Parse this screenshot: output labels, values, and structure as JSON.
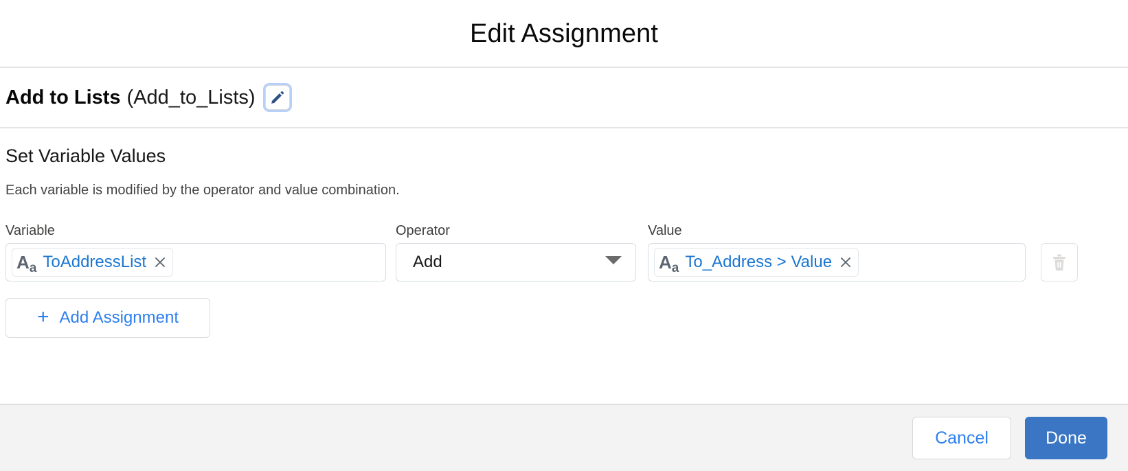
{
  "modal": {
    "title": "Edit Assignment"
  },
  "element": {
    "label": "Add to Lists",
    "api_name": "(Add_to_Lists)",
    "edit_icon": "pencil-icon",
    "edit_button_tooltip": "Edit"
  },
  "section": {
    "heading": "Set Variable Values",
    "description": "Each variable is modified by the operator and value combination."
  },
  "assignment_table": {
    "columns": {
      "variable": "Variable",
      "operator": "Operator",
      "value": "Value"
    },
    "rows": [
      {
        "variable": {
          "icon": "text-format-icon",
          "icon_text": "Aa",
          "text": "ToAddressList",
          "remove_icon": "close-icon"
        },
        "operator": {
          "selected": "Add",
          "arrow_icon": "chevron-down-icon"
        },
        "value": {
          "icon": "text-format-icon",
          "icon_text": "Aa",
          "text": "To_Address > Value",
          "remove_icon": "close-icon"
        },
        "delete": {
          "icon": "trash-icon",
          "enabled": false
        }
      }
    ]
  },
  "actions": {
    "add_assignment": {
      "plus_icon": "plus-icon",
      "label": "Add Assignment"
    },
    "cancel": "Cancel",
    "done": "Done"
  },
  "colors": {
    "link_blue": "#2d7ff0",
    "pill_blue": "#1b76d2",
    "primary_button": "#3a76c4",
    "footer_bg": "#f3f3f3",
    "border": "#d8dde3",
    "disabled_icon": "#dddbda"
  }
}
